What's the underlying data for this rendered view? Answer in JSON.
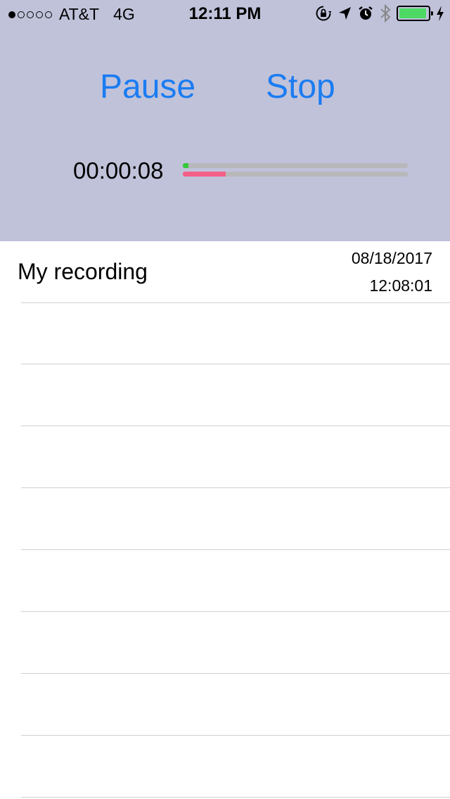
{
  "status_bar": {
    "signal_bars_filled": 1,
    "signal_bars_total": 5,
    "carrier": "AT&T",
    "network": "4G",
    "time": "12:11 PM",
    "icons": [
      "orientation-lock-icon",
      "location-arrow-icon",
      "alarm-icon",
      "bluetooth-icon",
      "battery-icon",
      "charging-bolt-icon"
    ],
    "battery_level": 0.95,
    "battery_color": "#4cd964"
  },
  "controls": {
    "pause_label": "Pause",
    "stop_label": "Stop",
    "button_color": "#1a7cf2"
  },
  "recorder": {
    "elapsed": "00:00:08",
    "meters": [
      {
        "level": 0.025,
        "color": "#34c83a"
      },
      {
        "level": 0.19,
        "color": "#f35f86"
      }
    ]
  },
  "recordings": [
    {
      "name": "My recording",
      "date": "08/18/2017",
      "time": "12:08:01"
    }
  ],
  "empty_rows": 8,
  "colors": {
    "header_bg": "#c0c2da",
    "separator": "#d0d0d4"
  }
}
